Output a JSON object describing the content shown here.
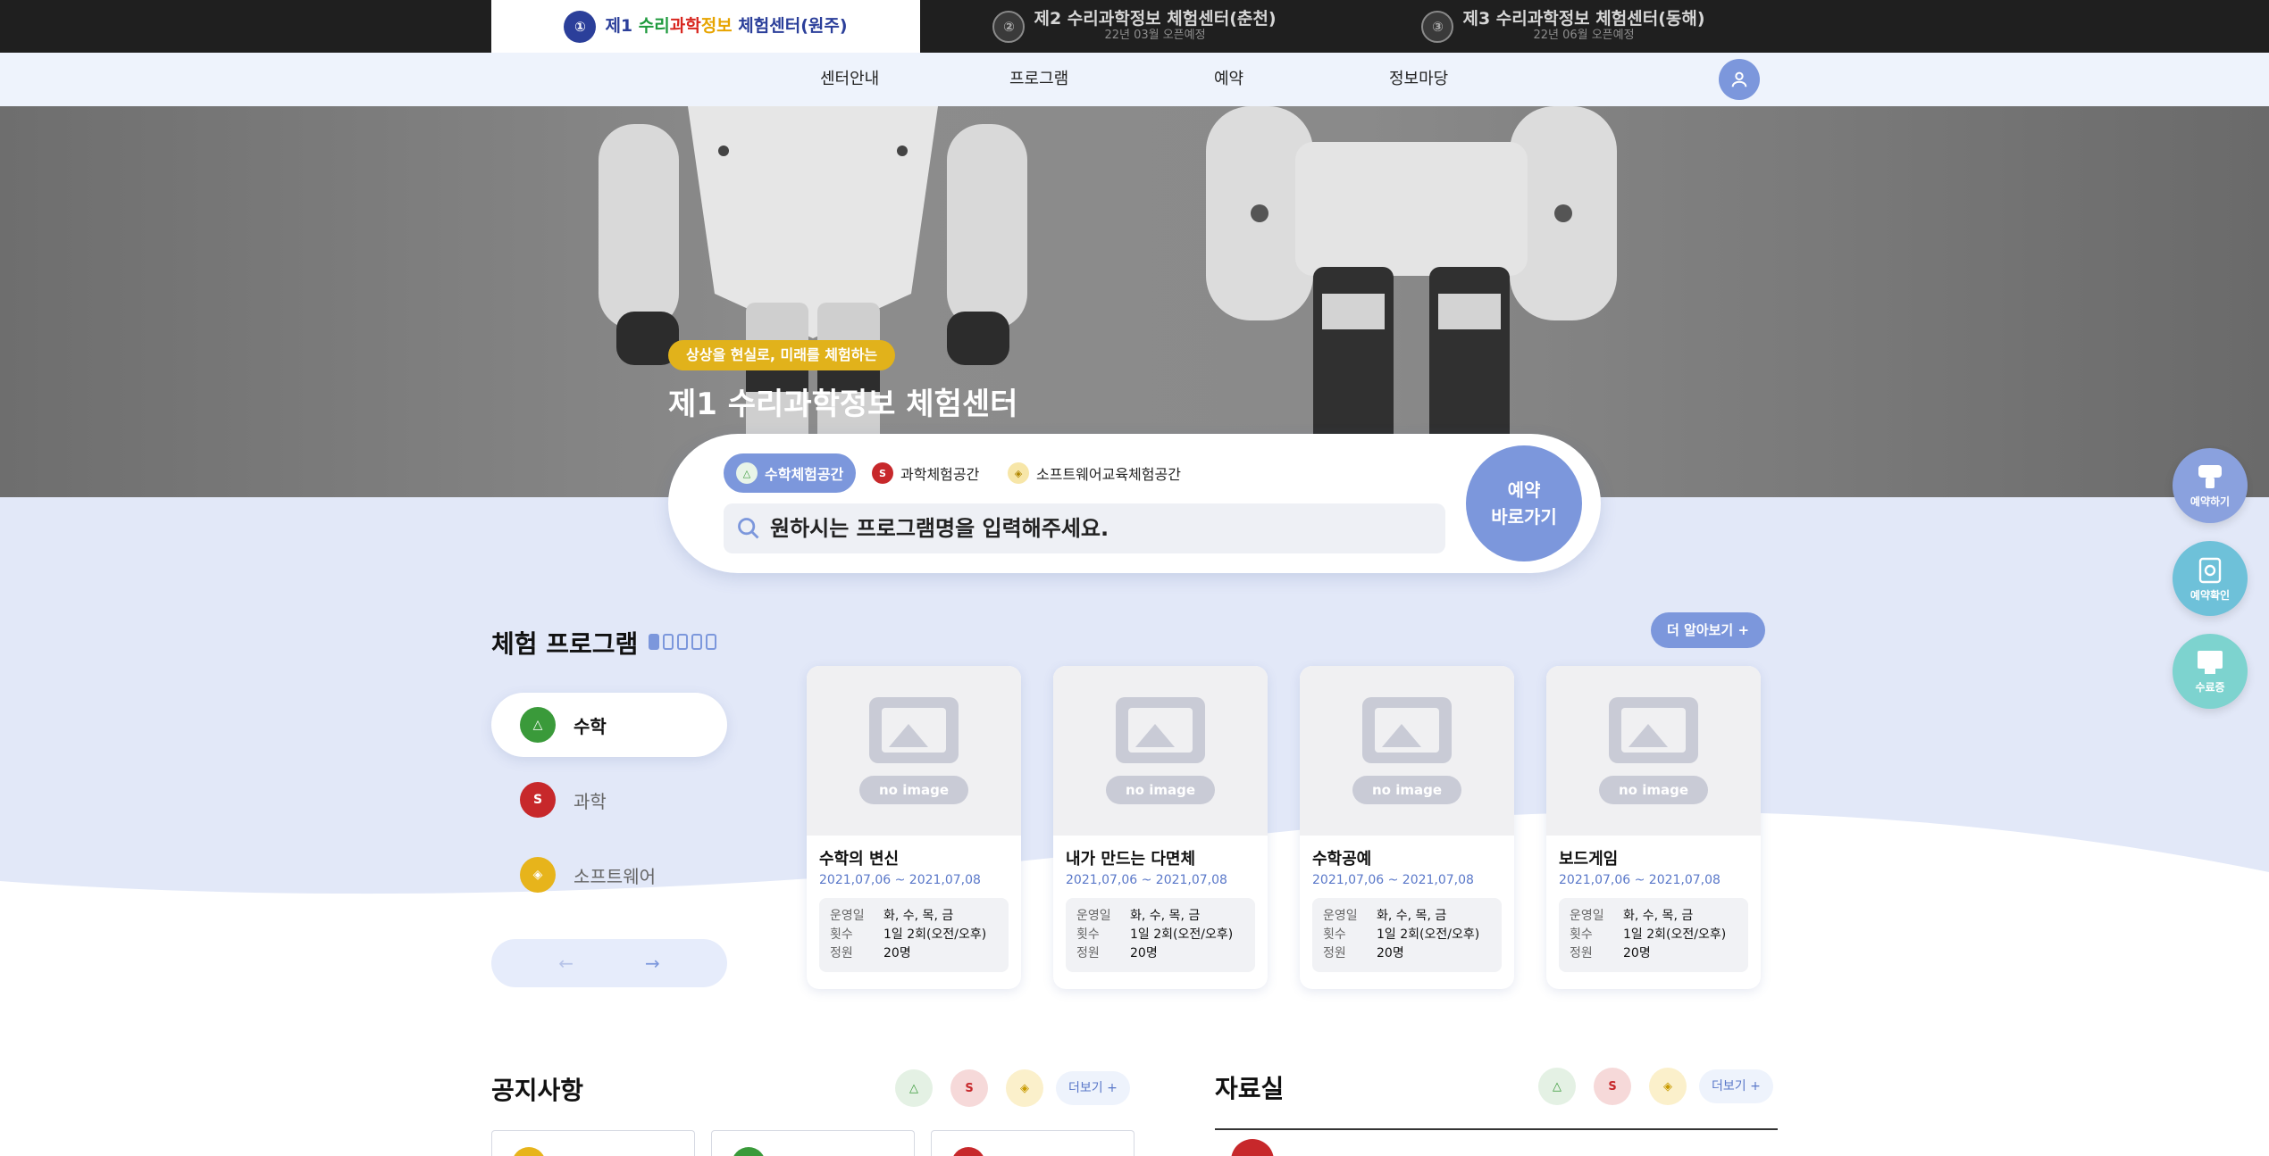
{
  "center_tabs": [
    {
      "title_parts": [
        "제1 ",
        "수리",
        "과학",
        "정보",
        " 체험센터(원주)"
      ],
      "subtitle": "",
      "logo": "①"
    },
    {
      "title": "제2 수리과학정보 체험센터(춘천)",
      "subtitle": "22년 03월 오픈예정",
      "logo": "②"
    },
    {
      "title": "제3 수리과학정보 체험센터(동해)",
      "subtitle": "22년 06월 오픈예정",
      "logo": "③"
    }
  ],
  "nav": {
    "items": [
      "센터안내",
      "프로그램",
      "예약",
      "정보마당"
    ],
    "user_icon": "user-icon"
  },
  "hero": {
    "badge": "상상을 현실로, 미래를 체험하는",
    "title": "제1 수리과학정보 체험센터"
  },
  "search": {
    "tabs": [
      {
        "label": "수학체험공간",
        "icon": "math-icon",
        "color": "#3a9a3a"
      },
      {
        "label": "과학체험공간",
        "icon": "science-icon",
        "color": "#c7282b"
      },
      {
        "label": "소프트웨어교육체험공간",
        "icon": "software-icon",
        "color": "#e7b41b"
      }
    ],
    "placeholder": "원하시는 프로그램명을 입력해주세요.",
    "go_label_1": "예약",
    "go_label_2": "바로가기"
  },
  "float_menu": [
    {
      "label": "예약하기",
      "icon": "reserve-icon"
    },
    {
      "label": "예약확인",
      "icon": "check-icon"
    },
    {
      "label": "수료증",
      "icon": "certificate-icon"
    }
  ],
  "programs": {
    "title": "체험 프로그램",
    "more_label": "더 알아보기 +",
    "categories": [
      {
        "label": "수학",
        "icon": "math-icon",
        "color": "#3a9a3a",
        "active": true
      },
      {
        "label": "과학",
        "icon": "science-icon",
        "color": "#c7282b",
        "active": false
      },
      {
        "label": "소프트웨어",
        "icon": "software-icon",
        "color": "#e7b41b",
        "active": false
      }
    ],
    "pager_count": "",
    "cards": [
      {
        "title": "수학의 변신",
        "date": "2021,07,06 ~ 2021,07,08",
        "noimg": "no image",
        "rows": [
          {
            "k": "운영일",
            "v": "화, 수, 목, 금"
          },
          {
            "k": "횟수",
            "v": "1일 2회(오전/오후)"
          },
          {
            "k": "정원",
            "v": "20명"
          }
        ]
      },
      {
        "title": "내가 만드는 다면체",
        "date": "2021,07,06 ~ 2021,07,08",
        "noimg": "no image",
        "rows": [
          {
            "k": "운영일",
            "v": "화, 수, 목, 금"
          },
          {
            "k": "횟수",
            "v": "1일 2회(오전/오후)"
          },
          {
            "k": "정원",
            "v": "20명"
          }
        ]
      },
      {
        "title": "수학공예",
        "date": "2021,07,06 ~ 2021,07,08",
        "noimg": "no image",
        "rows": [
          {
            "k": "운영일",
            "v": "화, 수, 목, 금"
          },
          {
            "k": "횟수",
            "v": "1일 2회(오전/오후)"
          },
          {
            "k": "정원",
            "v": "20명"
          }
        ]
      },
      {
        "title": "보드게임",
        "date": "2021,07,06 ~ 2021,07,08",
        "noimg": "no image",
        "rows": [
          {
            "k": "운영일",
            "v": "화, 수, 목, 금"
          },
          {
            "k": "횟수",
            "v": "1일 2회(오전/오후)"
          },
          {
            "k": "정원",
            "v": "20명"
          }
        ]
      }
    ]
  },
  "notice": {
    "title": "공지사항",
    "more_label": "더보기 +"
  },
  "archive": {
    "title": "자료실",
    "more_label": "더보기 +"
  },
  "colors": {
    "accent": "#7c97dc",
    "math": "#3a9a3a",
    "science": "#c7282b",
    "software": "#e7b41b"
  }
}
